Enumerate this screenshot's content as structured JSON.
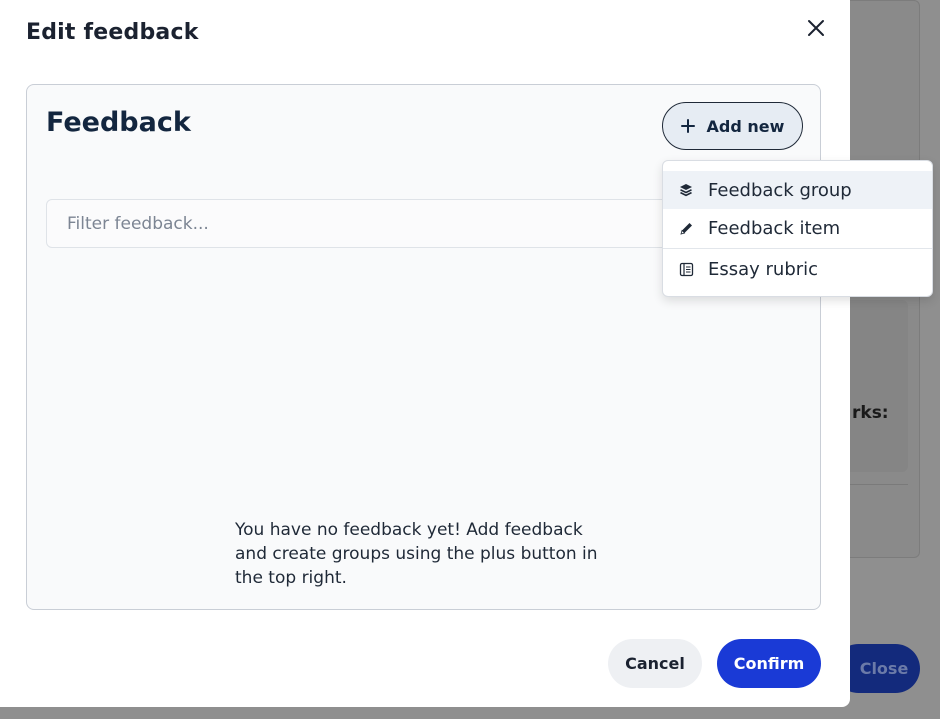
{
  "background": {
    "marks_label": "rks:",
    "close_label": "Close"
  },
  "modal": {
    "title": "Edit feedback",
    "close_icon": "close-icon"
  },
  "panel": {
    "title": "Feedback",
    "add_new_label": "Add new",
    "add_new_icon": "plus-icon",
    "filter_placeholder": "Filter feedback...",
    "filter_value": "",
    "empty_message": "You have no feedback yet! Add feedback and create groups using the plus button in the top right."
  },
  "dropdown": {
    "items": [
      {
        "label": "Feedback group",
        "icon": "layers-icon",
        "highlighted": true
      },
      {
        "label": "Feedback item",
        "icon": "pencil-icon",
        "highlighted": false
      },
      {
        "label": "Essay rubric",
        "icon": "rubric-icon",
        "highlighted": false
      }
    ]
  },
  "footer": {
    "cancel_label": "Cancel",
    "confirm_label": "Confirm"
  },
  "colors": {
    "confirm": "#1a3ad6",
    "overlay": "#8f8f8f",
    "panel_bg": "#f9fafb",
    "highlight": "#eef2f7"
  }
}
